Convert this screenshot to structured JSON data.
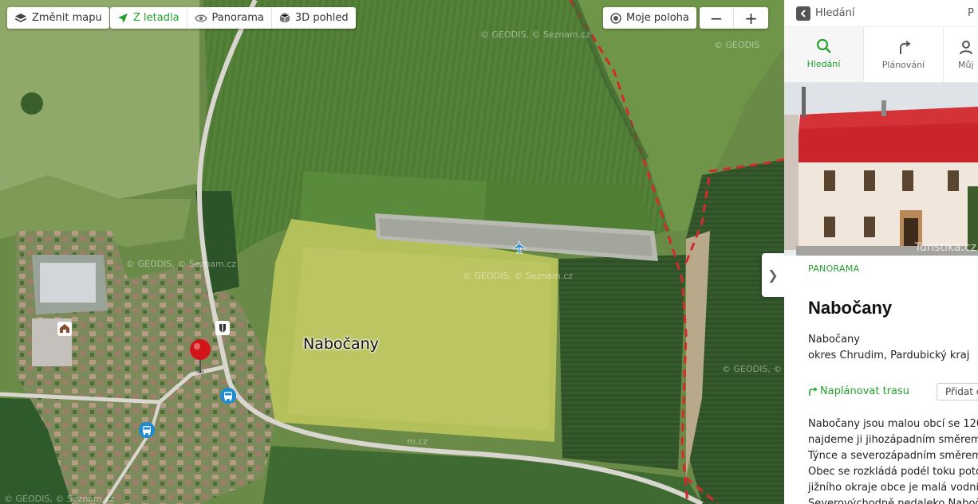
{
  "toolbar": {
    "change_map_label": "Změnit mapu",
    "views": [
      {
        "label": "Z letadla",
        "icon": "plane-icon",
        "active": true
      },
      {
        "label": "Panorama",
        "icon": "eye-icon",
        "active": false
      },
      {
        "label": "3D pohled",
        "icon": "cube-icon",
        "active": false
      }
    ],
    "my_location_label": "Moje poloha",
    "zoom_out_label": "−",
    "zoom_in_label": "+"
  },
  "map": {
    "copyrights": [
      "© GEODIS, © Seznam.cz",
      "© GEODIS, © Seznam.cz",
      "© GEODIS, © Seznam.cz",
      "© GEODIS, © Sezn",
      "© GEODIS, © Seznam.cz",
      "© GEODIS, © Seznam.cz",
      "© GEODIS",
      "m.cz",
      "© GEODIS, ©"
    ],
    "place_label": "Nabočany",
    "expand_label": "❯"
  },
  "panel": {
    "back_label": "Hledání",
    "right_fragment": "P",
    "tabs": [
      {
        "label": "Hledání",
        "icon": "search-icon",
        "active": true
      },
      {
        "label": "Plánování",
        "icon": "route-icon",
        "active": false
      },
      {
        "label": "Můj",
        "icon": "user-icon",
        "active": false
      }
    ],
    "photo_credit": "Turistika.cz",
    "kind": "PANORAMA",
    "title": "Nabočany",
    "subtitle_line1": "Nabočany",
    "subtitle_line2": "okres Chrudim, Pardubický kraj",
    "plan_route_label": "Naplánovat trasu",
    "add_label": "Přidat c",
    "description": [
      "Nabočany jsou malou obcí se 120",
      "najdeme ji jihozápadním směrem",
      "Týnce a severozápadním směrem",
      "Obec se rozkládá podél toku poto",
      "jižního okraje obce je malá vodní",
      "Severovýchodně nedaleko Naboč"
    ]
  },
  "colors": {
    "accent_green": "#24a12f",
    "pin_red": "#d4141b",
    "roof_red": "#c9252b"
  }
}
